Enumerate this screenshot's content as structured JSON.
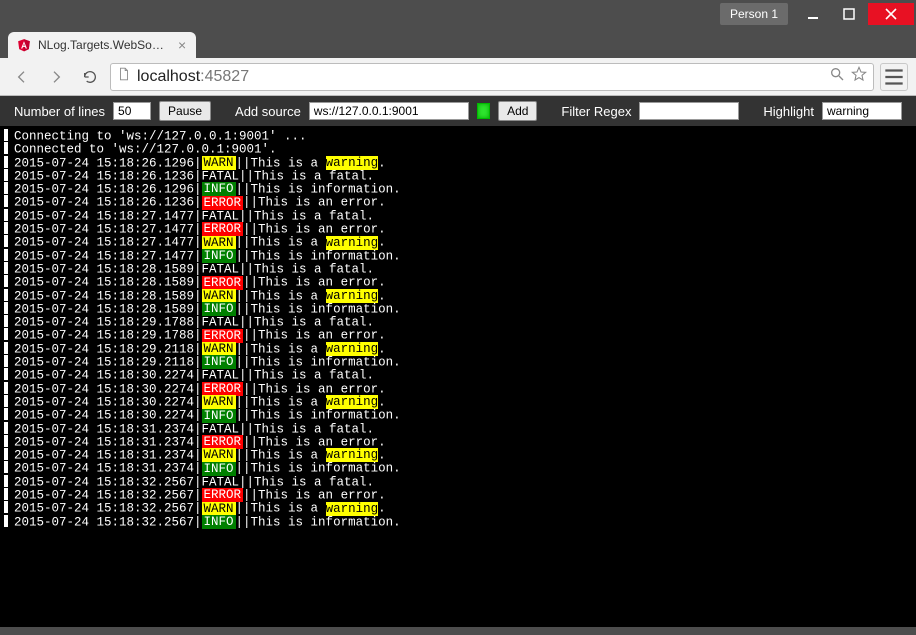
{
  "window": {
    "profile_label": "Person 1"
  },
  "tab": {
    "title": "NLog.Targets.WebSocketS"
  },
  "address": {
    "host": "localhost",
    "port": ":45827"
  },
  "toolbar": {
    "num_lines_label": "Number of lines",
    "num_lines_value": "50",
    "pause_label": "Pause",
    "add_source_label": "Add source",
    "add_source_value": "ws://127.0.0.1:9001",
    "add_button_label": "Add",
    "filter_label": "Filter Regex",
    "filter_value": "",
    "highlight_label": "Highlight",
    "highlight_value": "warning"
  },
  "console": {
    "highlight": "warning",
    "preamble": [
      "Connecting to 'ws://127.0.0.1:9001' ...",
      "Connected to 'ws://127.0.0.1:9001'."
    ],
    "lines": [
      {
        "ts": "2015-07-24 15:18:26.1296",
        "level": "WARN",
        "msg": "This is a warning."
      },
      {
        "ts": "2015-07-24 15:18:26.1236",
        "level": "FATAL",
        "msg": "This is a fatal."
      },
      {
        "ts": "2015-07-24 15:18:26.1296",
        "level": "INFO",
        "msg": "This is information."
      },
      {
        "ts": "2015-07-24 15:18:26.1236",
        "level": "ERROR",
        "msg": "This is an error."
      },
      {
        "ts": "2015-07-24 15:18:27.1477",
        "level": "FATAL",
        "msg": "This is a fatal."
      },
      {
        "ts": "2015-07-24 15:18:27.1477",
        "level": "ERROR",
        "msg": "This is an error."
      },
      {
        "ts": "2015-07-24 15:18:27.1477",
        "level": "WARN",
        "msg": "This is a warning."
      },
      {
        "ts": "2015-07-24 15:18:27.1477",
        "level": "INFO",
        "msg": "This is information."
      },
      {
        "ts": "2015-07-24 15:18:28.1589",
        "level": "FATAL",
        "msg": "This is a fatal."
      },
      {
        "ts": "2015-07-24 15:18:28.1589",
        "level": "ERROR",
        "msg": "This is an error."
      },
      {
        "ts": "2015-07-24 15:18:28.1589",
        "level": "WARN",
        "msg": "This is a warning."
      },
      {
        "ts": "2015-07-24 15:18:28.1589",
        "level": "INFO",
        "msg": "This is information."
      },
      {
        "ts": "2015-07-24 15:18:29.1788",
        "level": "FATAL",
        "msg": "This is a fatal."
      },
      {
        "ts": "2015-07-24 15:18:29.1788",
        "level": "ERROR",
        "msg": "This is an error."
      },
      {
        "ts": "2015-07-24 15:18:29.2118",
        "level": "WARN",
        "msg": "This is a warning."
      },
      {
        "ts": "2015-07-24 15:18:29.2118",
        "level": "INFO",
        "msg": "This is information."
      },
      {
        "ts": "2015-07-24 15:18:30.2274",
        "level": "FATAL",
        "msg": "This is a fatal."
      },
      {
        "ts": "2015-07-24 15:18:30.2274",
        "level": "ERROR",
        "msg": "This is an error."
      },
      {
        "ts": "2015-07-24 15:18:30.2274",
        "level": "WARN",
        "msg": "This is a warning."
      },
      {
        "ts": "2015-07-24 15:18:30.2274",
        "level": "INFO",
        "msg": "This is information."
      },
      {
        "ts": "2015-07-24 15:18:31.2374",
        "level": "FATAL",
        "msg": "This is a fatal."
      },
      {
        "ts": "2015-07-24 15:18:31.2374",
        "level": "ERROR",
        "msg": "This is an error."
      },
      {
        "ts": "2015-07-24 15:18:31.2374",
        "level": "WARN",
        "msg": "This is a warning."
      },
      {
        "ts": "2015-07-24 15:18:31.2374",
        "level": "INFO",
        "msg": "This is information."
      },
      {
        "ts": "2015-07-24 15:18:32.2567",
        "level": "FATAL",
        "msg": "This is a fatal."
      },
      {
        "ts": "2015-07-24 15:18:32.2567",
        "level": "ERROR",
        "msg": "This is an error."
      },
      {
        "ts": "2015-07-24 15:18:32.2567",
        "level": "WARN",
        "msg": "This is a warning."
      },
      {
        "ts": "2015-07-24 15:18:32.2567",
        "level": "INFO",
        "msg": "This is information."
      }
    ]
  }
}
